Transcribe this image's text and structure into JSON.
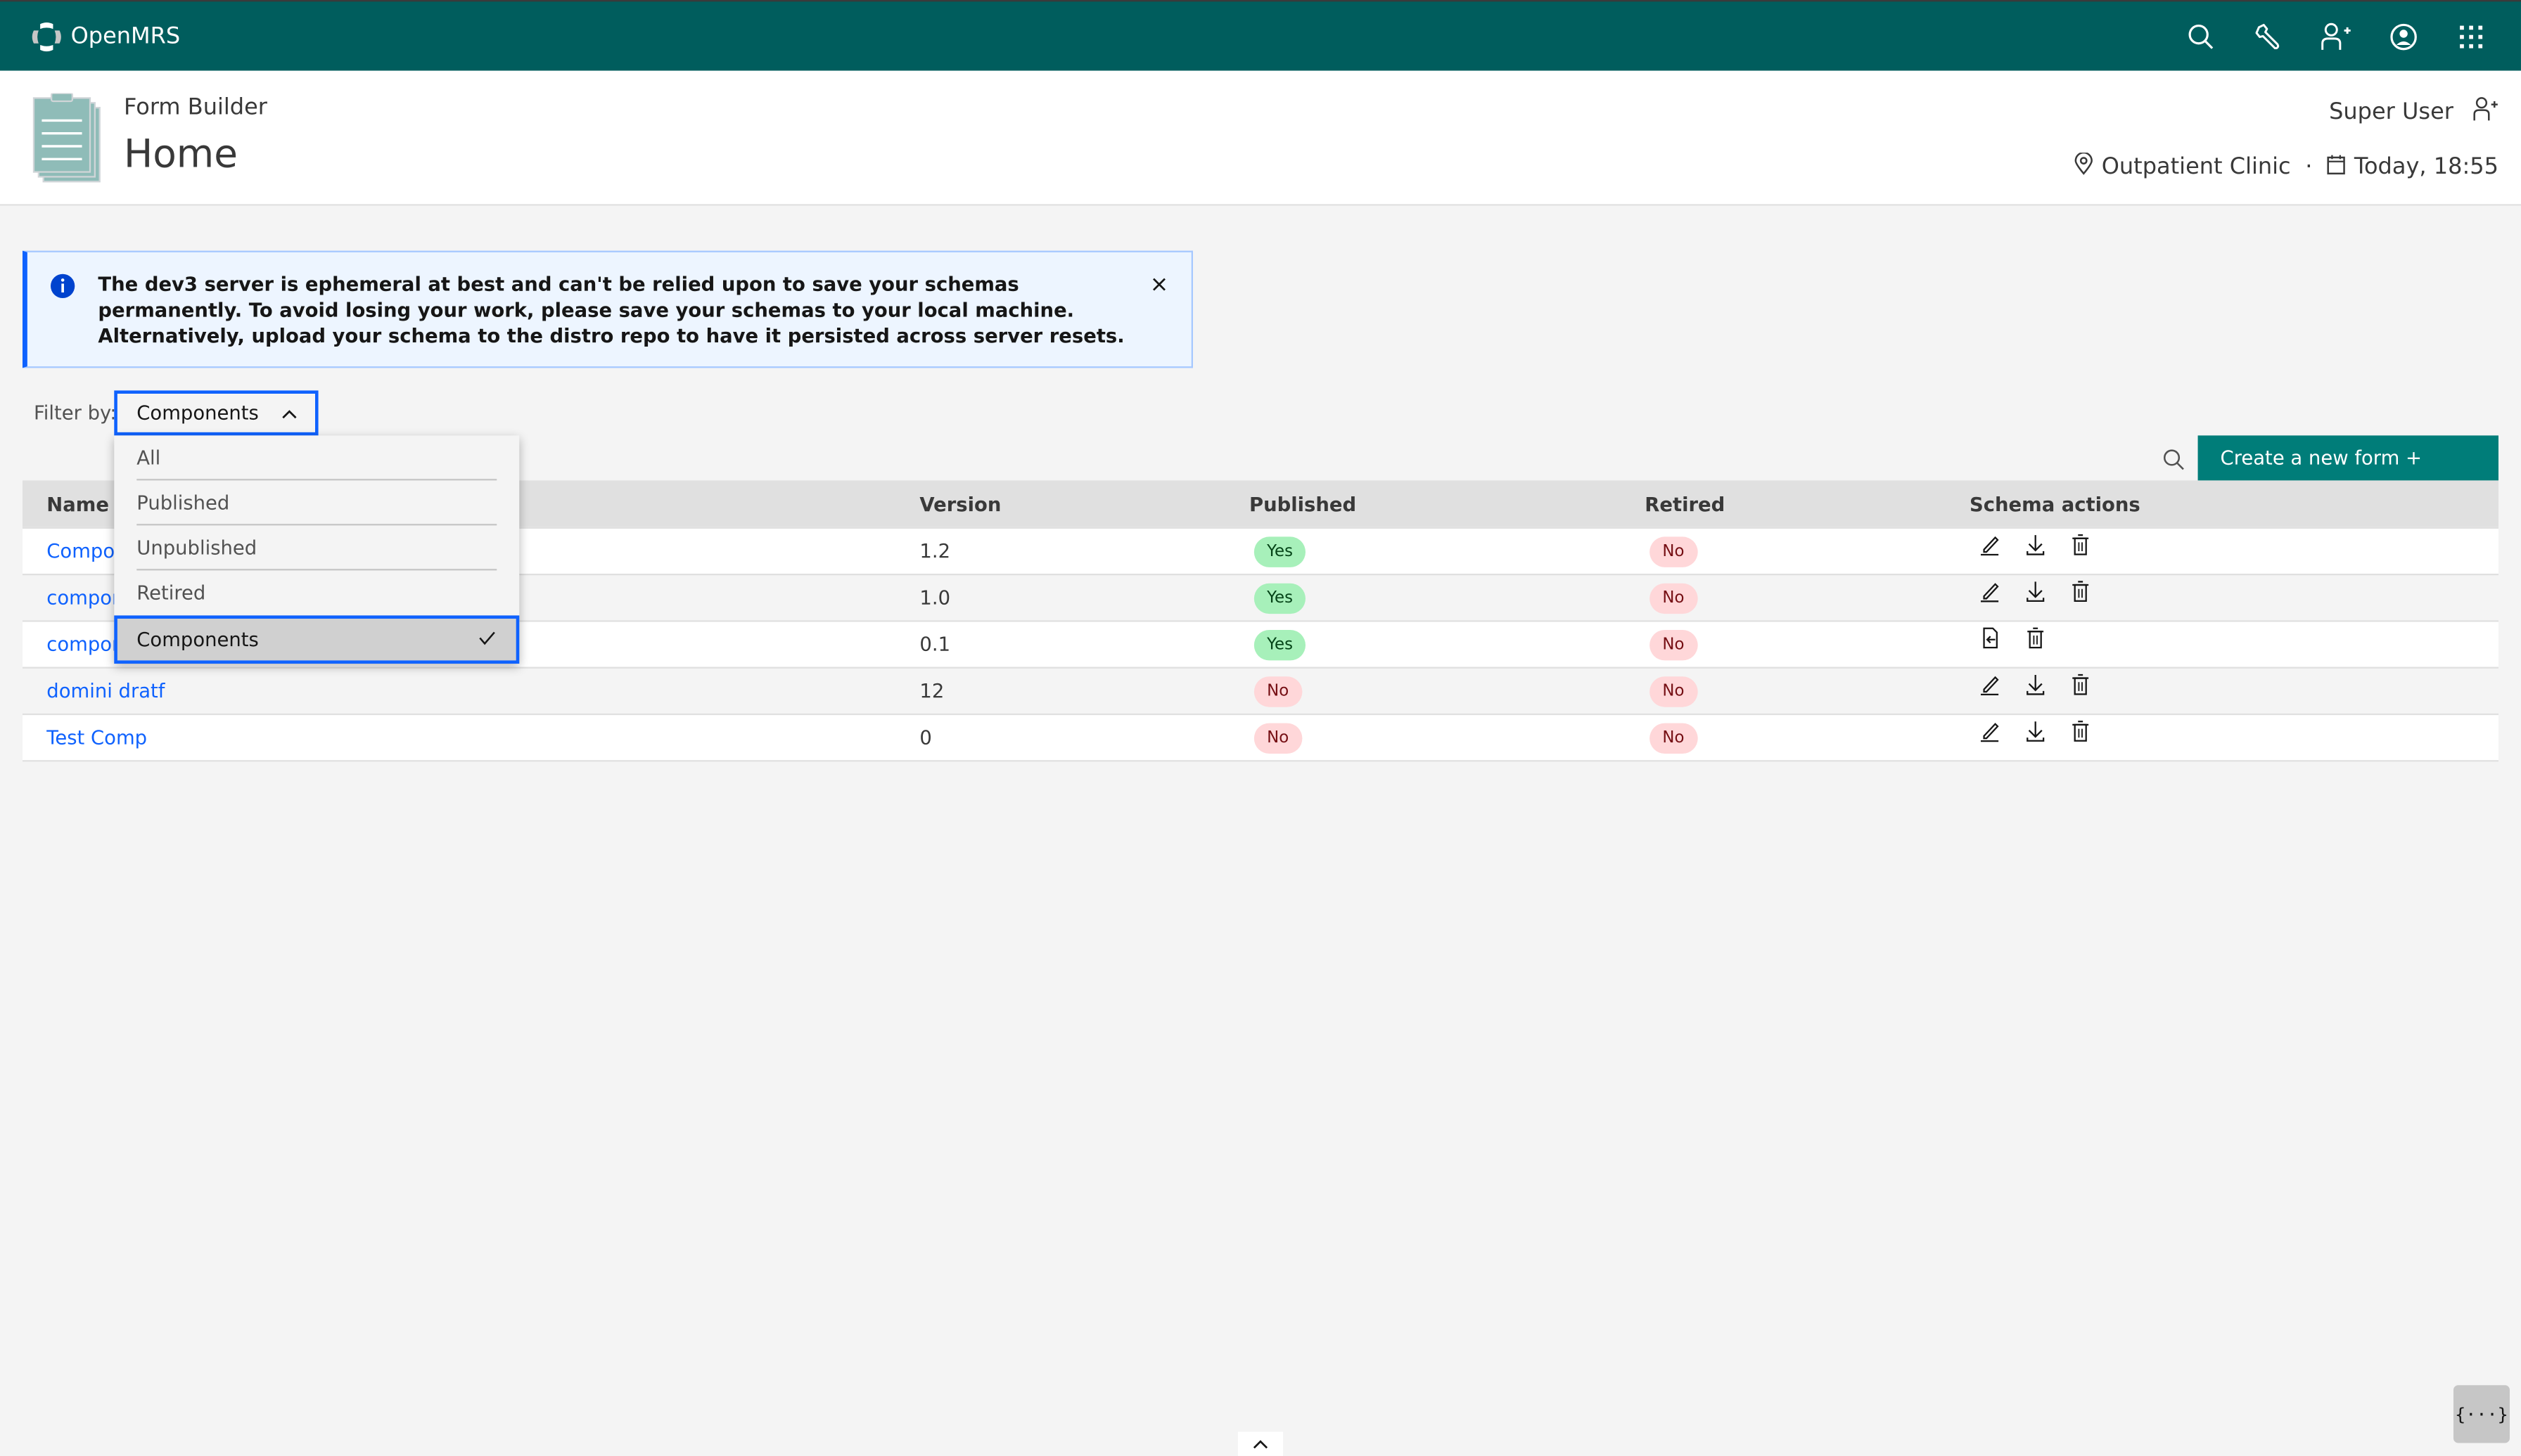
{
  "topbar": {
    "brand": "OpenMRS",
    "icons": [
      "search-icon",
      "wrench-icon",
      "add-patient-icon",
      "user-avatar-icon",
      "app-switcher-icon"
    ]
  },
  "subheader": {
    "app_name": "Form Builder",
    "page_title": "Home",
    "user_name": "Super User",
    "location": "Outpatient Clinic",
    "separator": "·",
    "datetime": "Today, 18:55"
  },
  "notification": {
    "kind": "info",
    "message": "The dev3 server is ephemeral at best and can't be relied upon to save your schemas permanently. To avoid losing your work, please save your schemas to your local machine. Alternatively, upload your schema to the distro repo to have it persisted across server resets."
  },
  "filter": {
    "label": "Filter by:",
    "selected": "Components",
    "options": [
      {
        "label": "All",
        "selected": false
      },
      {
        "label": "Published",
        "selected": false
      },
      {
        "label": "Unpublished",
        "selected": false
      },
      {
        "label": "Retired",
        "selected": false
      },
      {
        "label": "Components",
        "selected": true
      }
    ]
  },
  "toolbar": {
    "create_label": "Create a new form +"
  },
  "table": {
    "headers": {
      "name": "Name",
      "version": "Version",
      "published": "Published",
      "retired": "Retired",
      "actions": "Schema actions"
    },
    "rows": [
      {
        "name": "Compon",
        "version": "1.2",
        "published": "Yes",
        "retired": "No",
        "actions": [
          "edit",
          "download",
          "delete"
        ]
      },
      {
        "name": "compon",
        "version": "1.0",
        "published": "Yes",
        "retired": "No",
        "actions": [
          "edit",
          "download",
          "delete"
        ]
      },
      {
        "name": "compon",
        "version": "0.1",
        "published": "Yes",
        "retired": "No",
        "actions": [
          "import",
          "delete"
        ]
      },
      {
        "name": "domini dratf",
        "version": "12",
        "published": "No",
        "retired": "No",
        "actions": [
          "edit",
          "download",
          "delete"
        ]
      },
      {
        "name": "Test Comp",
        "version": "0",
        "published": "No",
        "retired": "No",
        "actions": [
          "edit",
          "download",
          "delete"
        ]
      }
    ]
  },
  "devtools": {
    "label": "{···}"
  },
  "colors": {
    "brand": "#005d5d",
    "primary_button": "#007d79",
    "link": "#0f62fe",
    "yes_badge": "#a7f0ba",
    "no_badge": "#ffd7d9"
  }
}
